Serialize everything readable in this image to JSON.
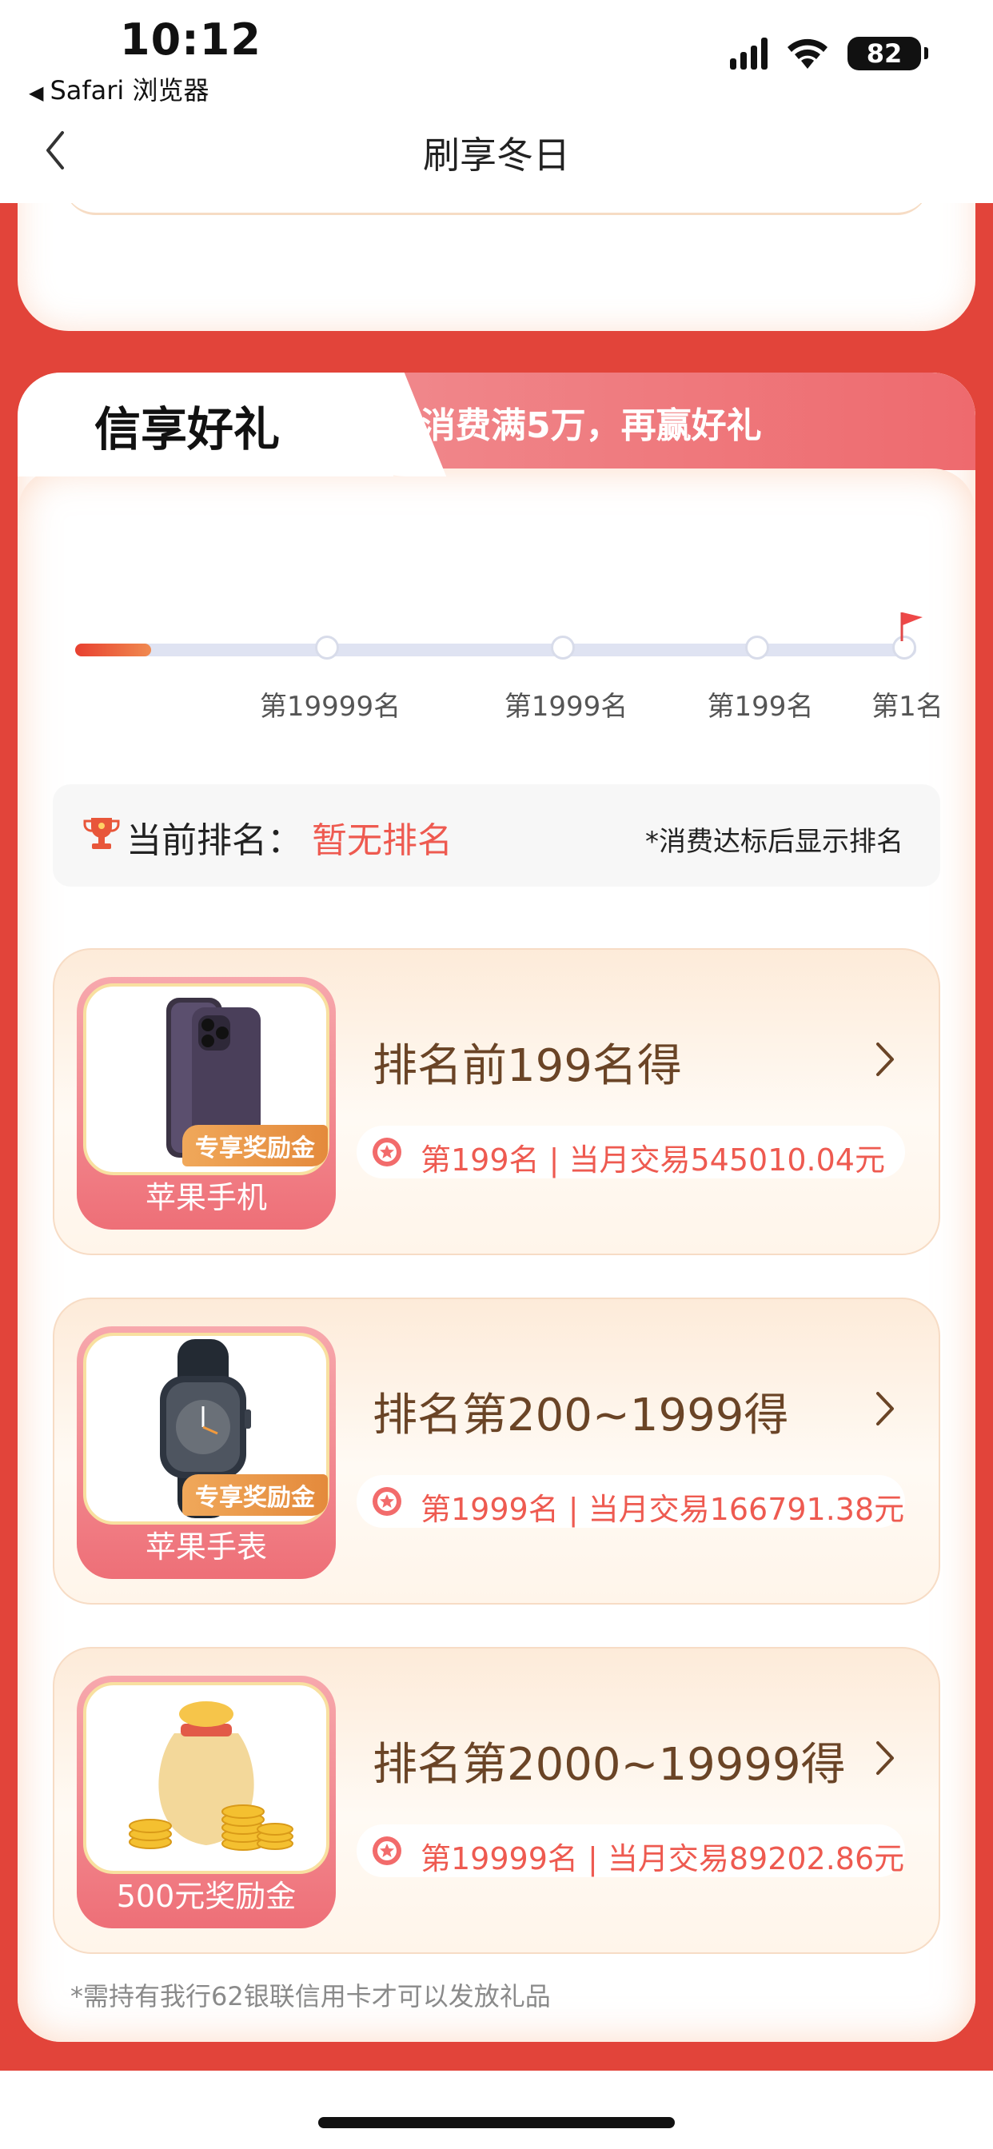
{
  "status_bar": {
    "time": "10:12",
    "back_app": "Safari 浏览器",
    "battery": "82"
  },
  "nav": {
    "title": "刷享冬日"
  },
  "section": {
    "title": "信享好礼",
    "subtitle": "消费满5万，再赢好礼"
  },
  "progress": {
    "fill_fraction": 0.09,
    "milestones": [
      "第19999名",
      "第1999名",
      "第199名",
      "第1名"
    ]
  },
  "rank": {
    "label": "当前排名：",
    "value": "暂无排名",
    "note": "*消费达标后显示排名"
  },
  "prizes": [
    {
      "title": "排名前199名得",
      "item": "苹果手机",
      "badge": "专享奖励金",
      "info": "第199名 | 当月交易545010.04元",
      "icon": "iphone-image"
    },
    {
      "title": "排名第200~1999得",
      "item": "苹果手表",
      "badge": "专享奖励金",
      "info": "第1999名 | 当月交易166791.38元",
      "icon": "watch-image"
    },
    {
      "title": "排名第2000~19999得",
      "item": "500元奖励金",
      "badge": "",
      "info": "第19999名 | 当月交易89202.86元",
      "icon": "money-bag-image"
    }
  ],
  "footnote": "*需持有我行62银联信用卡才可以发放礼品",
  "colors": {
    "primary_red": "#e2443a",
    "accent_text": "#ee5a50",
    "prize_title": "#6a4426"
  }
}
